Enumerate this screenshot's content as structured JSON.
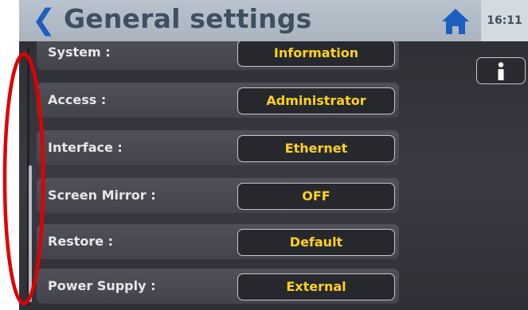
{
  "header": {
    "title": "General settings",
    "time": "16:11",
    "back_icon": "chevron-left-icon",
    "home_icon": "home-icon",
    "accent_color": "#1d5fbf"
  },
  "info_button": {
    "icon": "info-icon"
  },
  "settings": [
    {
      "label": "System :",
      "value": "Information"
    },
    {
      "label": "Access :",
      "value": "Administrator"
    },
    {
      "label": "Interface :",
      "value": "Ethernet"
    },
    {
      "label": "Screen Mirror :",
      "value": "OFF"
    },
    {
      "label": "Restore :",
      "value": "Default"
    },
    {
      "label": "Power Supply :",
      "value": "External"
    }
  ],
  "annotation": {
    "shape": "ellipse",
    "color": "#e00000"
  }
}
